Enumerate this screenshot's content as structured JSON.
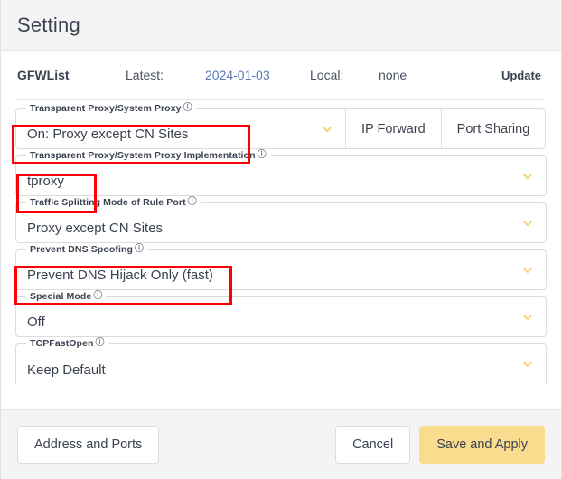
{
  "window": {
    "title": "Setting"
  },
  "gfwlist": {
    "name": "GFWList",
    "latest_label": "Latest:",
    "latest_value": "2024-01-03",
    "local_label": "Local:",
    "local_value": "none",
    "update_label": "Update",
    "date_color": "#5b7ab5"
  },
  "icons": {
    "help": "?",
    "chevron_down": "chevron-down"
  },
  "colors": {
    "accent": "#fadc8e",
    "chevron": "#f8d37a",
    "highlight": "#fb0007",
    "text": "#3b4250",
    "border": "#dcdcdc",
    "panel": "#f4f4f4"
  },
  "fields": [
    {
      "legend": "Transparent Proxy/System Proxy",
      "value": "On: Proxy except CN Sites",
      "help": true,
      "chevron": true,
      "split": true,
      "buttons": [
        "IP Forward",
        "Port Sharing"
      ],
      "highlighted": true
    },
    {
      "legend": "Transparent Proxy/System Proxy Implementation",
      "value": "tproxy",
      "help": true,
      "chevron": true,
      "split": false,
      "highlighted": true
    },
    {
      "legend": "Traffic Splitting Mode of Rule Port",
      "value": "Proxy except CN Sites",
      "help": true,
      "chevron": true,
      "split": false,
      "highlighted": false
    },
    {
      "legend": "Prevent DNS Spoofing",
      "value": "Prevent DNS Hijack Only (fast)",
      "help": true,
      "chevron": true,
      "split": false,
      "highlighted": true
    },
    {
      "legend": "Special Mode",
      "value": "Off",
      "help": true,
      "chevron": true,
      "split": false,
      "highlighted": false
    },
    {
      "legend": "TCPFastOpen",
      "value": "Keep Default",
      "help": true,
      "chevron": true,
      "split": false,
      "highlighted": false,
      "clipped": true
    }
  ],
  "segmented_buttons": {
    "ip_forward": "IP Forward",
    "port_sharing": "Port Sharing"
  },
  "footer": {
    "address_and_ports": "Address and Ports",
    "cancel": "Cancel",
    "save_and_apply": "Save and Apply"
  }
}
